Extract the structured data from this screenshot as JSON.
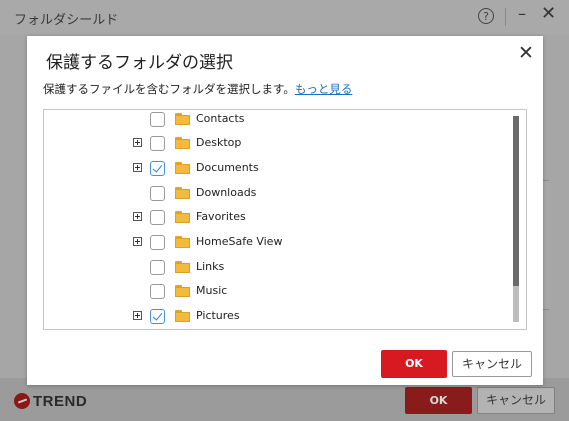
{
  "background": {
    "title": "フォルダシールド",
    "help_glyph": "?",
    "min_glyph": "–",
    "close_glyph": "✕",
    "logo_text": "TREND",
    "ok_label": "OK",
    "cancel_label": "キャンセル"
  },
  "dialog": {
    "title": "保護するフォルダの選択",
    "close_glyph": "✕",
    "description": "保護するファイルを含むフォルダを選択します。",
    "more_link": "もっと見る",
    "ok_label": "OK",
    "cancel_label": "キャンセル",
    "folders": [
      {
        "label": "Contacts",
        "checked": false,
        "expandable": false
      },
      {
        "label": "Desktop",
        "checked": false,
        "expandable": true
      },
      {
        "label": "Documents",
        "checked": true,
        "expandable": true
      },
      {
        "label": "Downloads",
        "checked": false,
        "expandable": false
      },
      {
        "label": "Favorites",
        "checked": false,
        "expandable": true
      },
      {
        "label": "HomeSafe View",
        "checked": false,
        "expandable": true
      },
      {
        "label": "Links",
        "checked": false,
        "expandable": false
      },
      {
        "label": "Music",
        "checked": false,
        "expandable": false
      },
      {
        "label": "Pictures",
        "checked": true,
        "expandable": true
      }
    ]
  },
  "colors": {
    "accent_red": "#d71921",
    "link_blue": "#1a6fc2",
    "folder_yellow": "#f2bb3c"
  }
}
